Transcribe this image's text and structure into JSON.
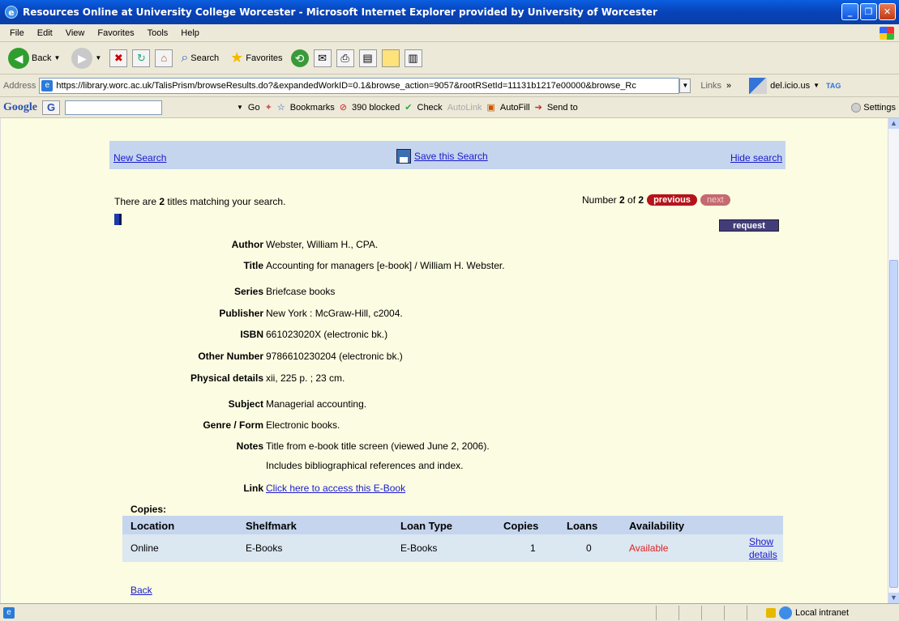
{
  "window": {
    "title": "Resources Online at University College Worcester - Microsoft Internet Explorer provided by University of Worcester"
  },
  "menu": [
    "File",
    "Edit",
    "View",
    "Favorites",
    "Tools",
    "Help"
  ],
  "toolbar": {
    "back": "Back",
    "search": "Search",
    "favorites": "Favorites"
  },
  "address": {
    "label": "Address",
    "url": "https://library.worc.ac.uk/TalisPrism/browseResults.do?&expandedWorkID=0.1&browse_action=9057&rootRSetId=11131b1217e00000&browse_Rc",
    "links": "Links",
    "delicious": "del.icio.us",
    "tag": "TAG"
  },
  "google": {
    "logo": "Google",
    "go": "Go",
    "bookmarks": "Bookmarks",
    "blocked": "390 blocked",
    "check": "Check",
    "autolink": "AutoLink",
    "autofill": "AutoFill",
    "sendto": "Send to",
    "settings": "Settings"
  },
  "page": {
    "new_search": "New Search",
    "save_search": "Save this Search",
    "hide_search": "Hide search",
    "matching_prefix": "There are ",
    "matching_count": "2",
    "matching_suffix": " titles matching your search.",
    "number_prefix": "Number ",
    "number_current": "2",
    "number_of": " of ",
    "number_total": "2",
    "previous": "previous",
    "next": "next",
    "request": "request",
    "fields": [
      {
        "label": "Author",
        "value": "Webster, William H., CPA."
      },
      {
        "label": "Title",
        "value": "Accounting for managers [e-book] / William H. Webster."
      },
      {
        "label": "Series",
        "value": "Briefcase books"
      },
      {
        "label": "Publisher",
        "value": "New York : McGraw-Hill, c2004."
      },
      {
        "label": "ISBN",
        "value": "661023020X (electronic bk.)"
      },
      {
        "label": "Other Number",
        "value": "9786610230204 (electronic bk.)"
      },
      {
        "label": "Physical details",
        "value": "xii, 225 p. ; 23 cm."
      },
      {
        "label": "Subject",
        "value": "Managerial accounting."
      },
      {
        "label": "Genre / Form",
        "value": "Electronic books."
      },
      {
        "label": "Notes",
        "value": "Title from e-book title screen (viewed June 2, 2006)."
      },
      {
        "label": "",
        "value": "Includes bibliographical references and index."
      },
      {
        "label": "Link",
        "value": "Click here to access this E-Book"
      }
    ],
    "copies_title": "Copies:",
    "copies_headers": [
      "Location",
      "Shelfmark",
      "Loan Type",
      "Copies",
      "Loans",
      "Availability"
    ],
    "copies_row": {
      "location": "Online",
      "shelfmark": "E-Books",
      "loan_type": "E-Books",
      "copies": "1",
      "loans": "0",
      "availability": "Available",
      "show": "Show",
      "details": "details"
    },
    "back": "Back"
  },
  "status": {
    "zone": "Local intranet"
  },
  "colors": {
    "page_bg": "#fbfce1",
    "band": "#c5d5ee",
    "link": "#1a1acc",
    "available": "#dd2222"
  }
}
